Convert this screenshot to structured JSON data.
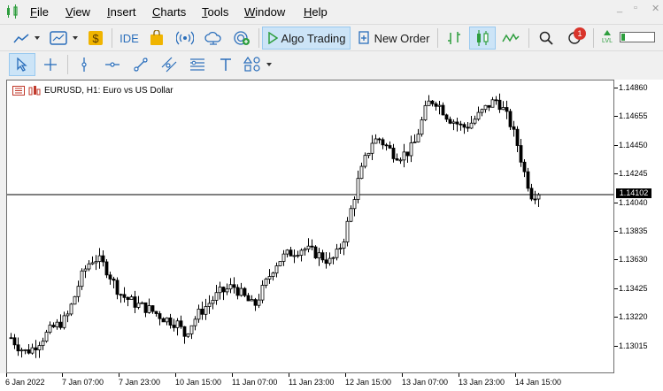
{
  "menu": [
    "File",
    "View",
    "Insert",
    "Charts",
    "Tools",
    "Window",
    "Help"
  ],
  "menu_underline": [
    "F",
    "V",
    "I",
    "C",
    "T",
    "W",
    "H"
  ],
  "window_controls": [
    "_",
    "▫",
    "✕"
  ],
  "toolbar": {
    "ide_label": "IDE",
    "algo_label": "Algo Trading",
    "new_order_label": "New Order",
    "notification_count": "1",
    "lvl_label": "LVL"
  },
  "chart": {
    "title": "EURUSD, H1:  Euro vs US Dollar",
    "current_price": "1.14102",
    "y_labels": [
      "1.14860",
      "1.14655",
      "1.14450",
      "1.14245",
      "1.14040",
      "1.13835",
      "1.13630",
      "1.13425",
      "1.13220",
      "1.13015"
    ],
    "x_labels": [
      "6 Jan 2022",
      "7 Jan 07:00",
      "7 Jan 23:00",
      "10 Jan 15:00",
      "11 Jan 07:00",
      "11 Jan 23:00",
      "12 Jan 15:00",
      "13 Jan 07:00",
      "13 Jan 23:00",
      "14 Jan 15:00"
    ]
  },
  "chart_data": {
    "type": "candlestick",
    "symbol": "EURUSD",
    "timeframe": "H1",
    "title": "EURUSD, H1:  Euro vs US Dollar",
    "ylim": [
      1.1285,
      1.149
    ],
    "current_price": 1.14102,
    "close_path": [
      1.1308,
      1.1302,
      1.1298,
      1.13,
      1.1305,
      1.131,
      1.1315,
      1.1318,
      1.1322,
      1.1335,
      1.135,
      1.136,
      1.1365,
      1.1362,
      1.1355,
      1.1345,
      1.1338,
      1.1335,
      1.1332,
      1.133,
      1.1328,
      1.1325,
      1.1322,
      1.132,
      1.1318,
      1.131,
      1.1318,
      1.1325,
      1.133,
      1.1335,
      1.134,
      1.1342,
      1.1345,
      1.134,
      1.1335,
      1.133,
      1.134,
      1.135,
      1.136,
      1.1365,
      1.1368,
      1.137,
      1.1372,
      1.137,
      1.1368,
      1.1365,
      1.1362,
      1.1368,
      1.138,
      1.14,
      1.142,
      1.1435,
      1.1448,
      1.145,
      1.1445,
      1.144,
      1.1438,
      1.144,
      1.1445,
      1.146,
      1.1475,
      1.1478,
      1.1472,
      1.1465,
      1.1462,
      1.1458,
      1.146,
      1.1465,
      1.147,
      1.1475,
      1.1478,
      1.147,
      1.146,
      1.1445,
      1.1425,
      1.141,
      1.1412
    ]
  }
}
